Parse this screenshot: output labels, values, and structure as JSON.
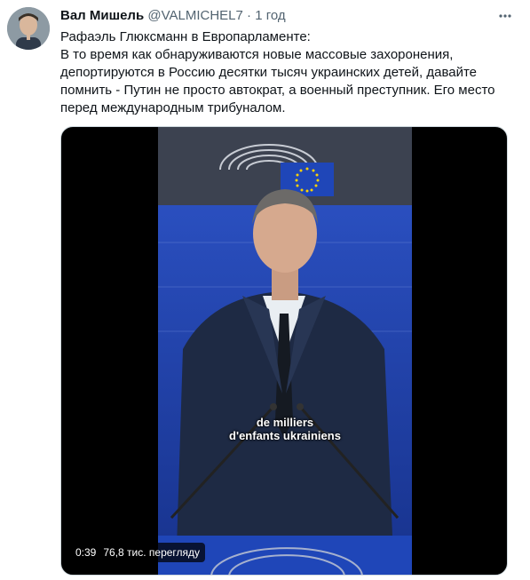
{
  "tweet": {
    "author_name": "Вал Мишель",
    "handle": "@VALMICHEL7",
    "separator": "·",
    "time": "1 год",
    "text_lines": [
      "Рафаэль Глюксманн в Европарламенте:",
      "В то время как обнаруживаются новые массовые захоронения,",
      "депортируются в Россию десятки тысяч украинских детей, давайте",
      "помнить - Путин не просто автократ, а военный преступник. Его место",
      "перед международным трибуналом."
    ]
  },
  "video": {
    "subtitle_line1": "de milliers",
    "subtitle_line2": "d'enfants ukrainiens",
    "duration": "0:39",
    "views": "76,8 тис. перегляду"
  },
  "colors": {
    "text_primary": "#0f1419",
    "text_secondary": "#536471",
    "eu_blue": "#1f46b8",
    "eu_star": "#ffd200"
  },
  "icons": {
    "more": "more-dots-icon"
  }
}
